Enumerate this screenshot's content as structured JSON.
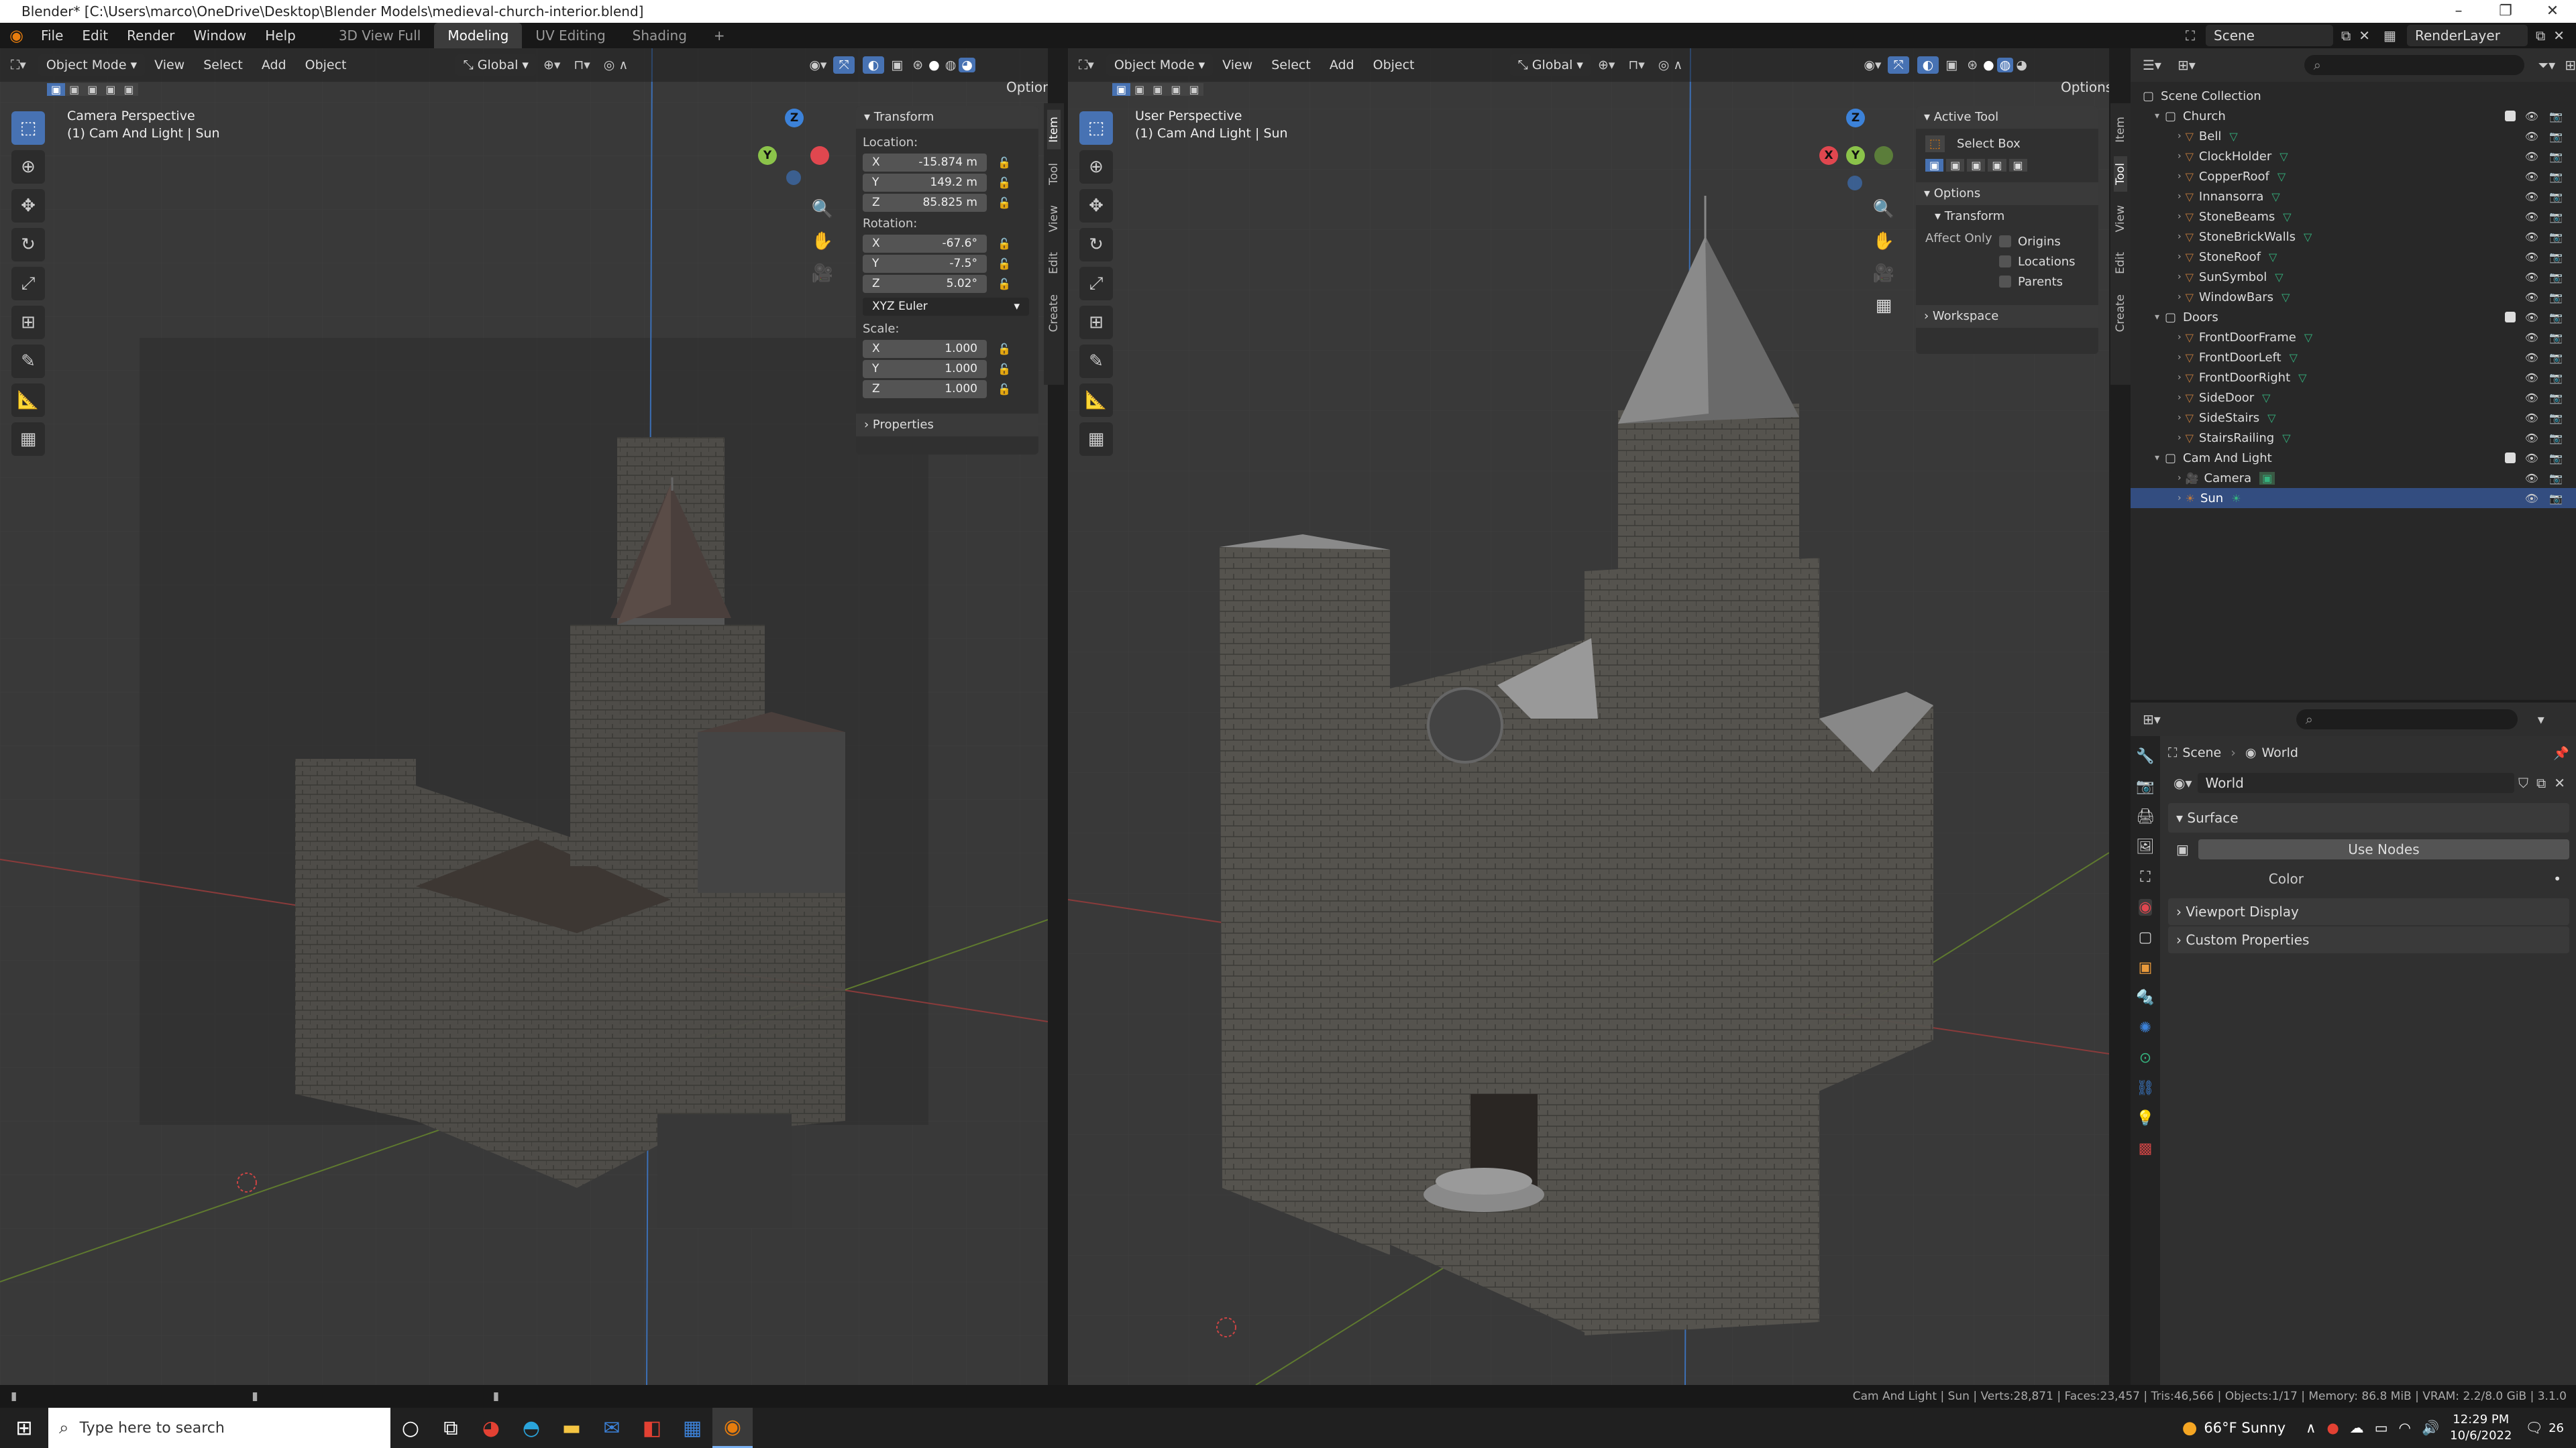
{
  "window": {
    "title": "Blender* [C:\\Users\\marco\\OneDrive\\Desktop\\Blender Models\\medieval-church-interior.blend]",
    "min": "–",
    "max": "❐",
    "close": "✕"
  },
  "menus": [
    "File",
    "Edit",
    "Render",
    "Window",
    "Help"
  ],
  "workspaces": [
    {
      "label": "3D View Full",
      "active": false
    },
    {
      "label": "Modeling",
      "active": true
    },
    {
      "label": "UV Editing",
      "active": false
    },
    {
      "label": "Shading",
      "active": false
    }
  ],
  "add_workspace": "+",
  "scene_label": "Scene",
  "view_layer_label": "RenderLayer",
  "viewport_left": {
    "mode": "Object Mode",
    "menus": [
      "View",
      "Select",
      "Add",
      "Object"
    ],
    "orientation": "Global",
    "options": "Options",
    "perspective": "Camera Perspective",
    "collection_info": "(1) Cam And Light | Sun"
  },
  "viewport_right": {
    "mode": "Object Mode",
    "menus": [
      "View",
      "Select",
      "Add",
      "Object"
    ],
    "orientation": "Global",
    "options": "Options",
    "perspective": "User Perspective",
    "collection_info": "(1) Cam And Light | Sun"
  },
  "transform_panel": {
    "title": "Transform",
    "location_label": "Location:",
    "location": [
      {
        "axis": "X",
        "value": "-15.874 m"
      },
      {
        "axis": "Y",
        "value": "149.2 m"
      },
      {
        "axis": "Z",
        "value": "85.825 m"
      }
    ],
    "rotation_label": "Rotation:",
    "rotation": [
      {
        "axis": "X",
        "value": "-67.6°"
      },
      {
        "axis": "Y",
        "value": "-7.5°"
      },
      {
        "axis": "Z",
        "value": "5.02°"
      }
    ],
    "rotation_mode": "XYZ Euler",
    "scale_label": "Scale:",
    "scale": [
      {
        "axis": "X",
        "value": "1.000"
      },
      {
        "axis": "Y",
        "value": "1.000"
      },
      {
        "axis": "Z",
        "value": "1.000"
      }
    ],
    "properties_label": "Properties"
  },
  "side_tabs": [
    "Item",
    "Tool",
    "View",
    "Edit",
    "Create"
  ],
  "active_tool_panel": {
    "title": "Active Tool",
    "tool_name": "Select Box",
    "options_label": "Options",
    "transform_label": "Transform",
    "affect_only_label": "Affect Only",
    "checks": [
      "Origins",
      "Locations",
      "Parents"
    ],
    "workspace_label": "Workspace"
  },
  "gizmo": {
    "z": "Z",
    "y": "Y",
    "x": "X"
  },
  "outliner": {
    "root": "Scene Collection",
    "collections": [
      {
        "name": "Church",
        "children": [
          "Bell",
          "ClockHolder",
          "CopperRoof",
          "Innansorra",
          "StoneBeams",
          "StoneBrickWalls",
          "StoneRoof",
          "SunSymbol",
          "WindowBars"
        ]
      },
      {
        "name": "Doors",
        "children": [
          "FrontDoorFrame",
          "FrontDoorLeft",
          "FrontDoorRight",
          "SideDoor",
          "SideStairs",
          "StairsRailing"
        ]
      },
      {
        "name": "Cam And Light",
        "children": [
          "Camera",
          "Sun"
        ]
      }
    ],
    "selected": "Sun"
  },
  "properties": {
    "breadcrumb_scene": "Scene",
    "breadcrumb_sep": "›",
    "breadcrumb_world": "World",
    "world_name": "World",
    "surface_label": "Surface",
    "use_nodes_label": "Use Nodes",
    "color_label": "Color",
    "viewport_display_label": "Viewport Display",
    "custom_properties_label": "Custom Properties"
  },
  "statusbar": {
    "info": "Cam And Light | Sun | Verts:28,871 | Faces:23,457 | Tris:46,566 | Objects:1/17 | Memory: 86.8 MiB | VRAM: 2.2/8.0 GiB | 3.1.0"
  },
  "taskbar": {
    "search_placeholder": "Type here to search",
    "weather": "66°F  Sunny",
    "time": "12:29 PM",
    "date": "10/6/2022",
    "notifications": "26"
  },
  "colors": {
    "accent_blue": "#4772b3",
    "selection": "#334d80",
    "axis_x": "#e0474f",
    "axis_y": "#8bc34a",
    "axis_z": "#3c82d9"
  }
}
